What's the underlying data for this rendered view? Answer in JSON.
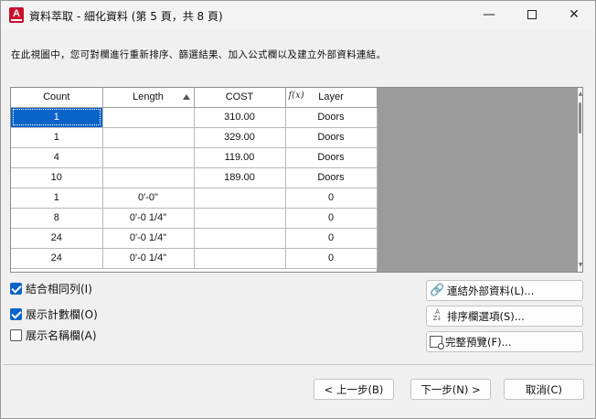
{
  "window": {
    "app_icon_letter": "A",
    "title": "資料萃取 - 細化資料 (第 5 頁，共 8 頁)"
  },
  "description": "在此視圖中，您可對欄進行重新排序、篩選結果、加入公式欄以及建立外部資料連結。",
  "grid": {
    "columns": [
      "Count",
      "Length",
      "COST",
      "Layer"
    ],
    "rows": [
      [
        "1",
        "",
        "310.00",
        "Doors"
      ],
      [
        "1",
        "",
        "329.00",
        "Doors"
      ],
      [
        "4",
        "",
        "119.00",
        "Doors"
      ],
      [
        "10",
        "",
        "189.00",
        "Doors"
      ],
      [
        "1",
        "0'-0\"",
        "",
        "0"
      ],
      [
        "8",
        "0'-0 1/4\"",
        "",
        "0"
      ],
      [
        "24",
        "0'-0 1/4\"",
        "",
        "0"
      ],
      [
        "24",
        "0'-0 1/4\"",
        "",
        "0"
      ]
    ]
  },
  "options": {
    "combine_rows": {
      "label": "結合相同列(I)",
      "checked": true
    },
    "show_count": {
      "label": "展示計數欄(O)",
      "checked": true
    },
    "show_name": {
      "label": "展示名稱欄(A)",
      "checked": false
    }
  },
  "buttons": {
    "link_external": "連結外部資料(L)...",
    "sort_options": "排序欄選項(S)...",
    "full_preview": "完整預覽(F)...",
    "back": "< 上一步(B)",
    "next": "下一步(N) >",
    "cancel": "取消(C)"
  },
  "colors": {
    "selection": "#0a64c8",
    "checkbox": "#0a64c8",
    "grid_background": "#9b9b9b"
  }
}
